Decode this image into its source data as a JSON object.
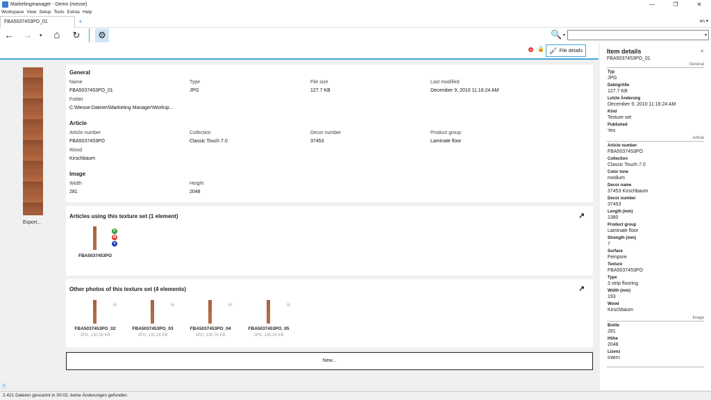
{
  "window": {
    "title": "Marketingmanager - Demo (messe)",
    "controls": [
      "—",
      "❐",
      "✕"
    ]
  },
  "menu": [
    "Workspace",
    "View",
    "Setup",
    "Tools",
    "Extras",
    "Help"
  ],
  "tabs": {
    "active": "FBA5037453PO_01",
    "add": "+",
    "lang": "en ▾"
  },
  "toolbar": {
    "back": "←",
    "forward": "→",
    "dropdown": "▾",
    "home": "⌂",
    "refresh": "↻",
    "settings": "⚙",
    "search_icon": "🔍",
    "search_dd": "▾",
    "search_placeholder": ""
  },
  "contentbar": {
    "badge": "M",
    "lock": "🔒",
    "file_details": "File details"
  },
  "preview": {
    "export": "Export..."
  },
  "general": {
    "title": "General",
    "name_lbl": "Name",
    "name": "FBA5037453PO_01",
    "type_lbl": "Type",
    "type": "JPG",
    "size_lbl": "File size",
    "size": "127.7 KB",
    "mod_lbl": "Last modified",
    "mod": "December 9, 2010 11:16:24 AM",
    "folder_lbl": "Folder",
    "folder": "C:\\Messe-Dateien\\Marketing Manager\\Worksp..."
  },
  "article": {
    "title": "Article",
    "an_lbl": "Article number",
    "an": "FBA5037453PO",
    "col_lbl": "Collection",
    "col": "Classic Touch 7.0",
    "dn_lbl": "Decor number",
    "dn": "37453",
    "pg_lbl": "Product group",
    "pg": "Laminate floor",
    "wood_lbl": "Wood",
    "wood": "Kirschbaum"
  },
  "image": {
    "title": "Image",
    "w_lbl": "Width",
    "w": "281",
    "h_lbl": "Height",
    "h": "2048"
  },
  "articles_using": {
    "title": "Articles using this texture set  (1 element)",
    "arrow": "↗",
    "item": "FBA5037453PO",
    "dots": [
      "P",
      "M",
      "V"
    ]
  },
  "other_photos": {
    "title": "Other photos of this texture set  (4 elements)",
    "arrow": "↗",
    "items": [
      {
        "name": "FBA5037453PO_02",
        "sub": "JPG, 130.38 KB"
      },
      {
        "name": "FBA5037453PO_03",
        "sub": "JPG, 132.26 KB"
      },
      {
        "name": "FBA5037453PO_04",
        "sub": "JPG, 130.76 KB"
      },
      {
        "name": "FBA5037453PO_05",
        "sub": "JPG, 130.26 KB"
      }
    ],
    "dot": "M"
  },
  "new_button": "New...",
  "side": {
    "title": "Item details",
    "close": "×",
    "id": "FBA5037453PO_01",
    "sec_general": "General",
    "sec_article": "Article",
    "sec_image": "Image",
    "typ_k": "Typ",
    "typ_v": "JPG",
    "ds_k": "Dateigröße",
    "ds_v": "127.7 KB",
    "la_k": "Letzte Änderung",
    "la_v": "December 9, 2010 11:16:24 AM",
    "kind_k": "Kind",
    "kind_v": "Texture set",
    "pub_k": "Published",
    "pub_v": "Yes",
    "an_k": "Article number",
    "an_v": "FBA5037453PO",
    "col_k": "Collection",
    "col_v": "Classic Touch 7.0",
    "ct_k": "Color tone",
    "ct_v": "medium",
    "dname_k": "Decor name",
    "dname_v": "37453 Kirschbaum",
    "dnum_k": "Decor number",
    "dnum_v": "37453",
    "len_k": "Length (mm)",
    "len_v": "1380",
    "pg_k": "Product group",
    "pg_v": "Laminate floor",
    "str_k": "Strength (mm)",
    "str_v": "7",
    "surf_k": "Surface",
    "surf_v": "Feinpore",
    "tex_k": "Texture",
    "tex_v": "FBA5037453PO",
    "type_k": "Type",
    "type_v": "3 strip flooring",
    "wid_k": "Width (mm)",
    "wid_v": "193",
    "wood_k": "Wood",
    "wood_v": "Kirschbaum",
    "br_k": "Breite",
    "br_v": "281",
    "ho_k": "Höhe",
    "ho_v": "2048",
    "li_k": "Lizenz",
    "li_v": "Intern"
  },
  "status": "2.421 Dateien gescannt in 00:02, keine Änderungen gefunden"
}
